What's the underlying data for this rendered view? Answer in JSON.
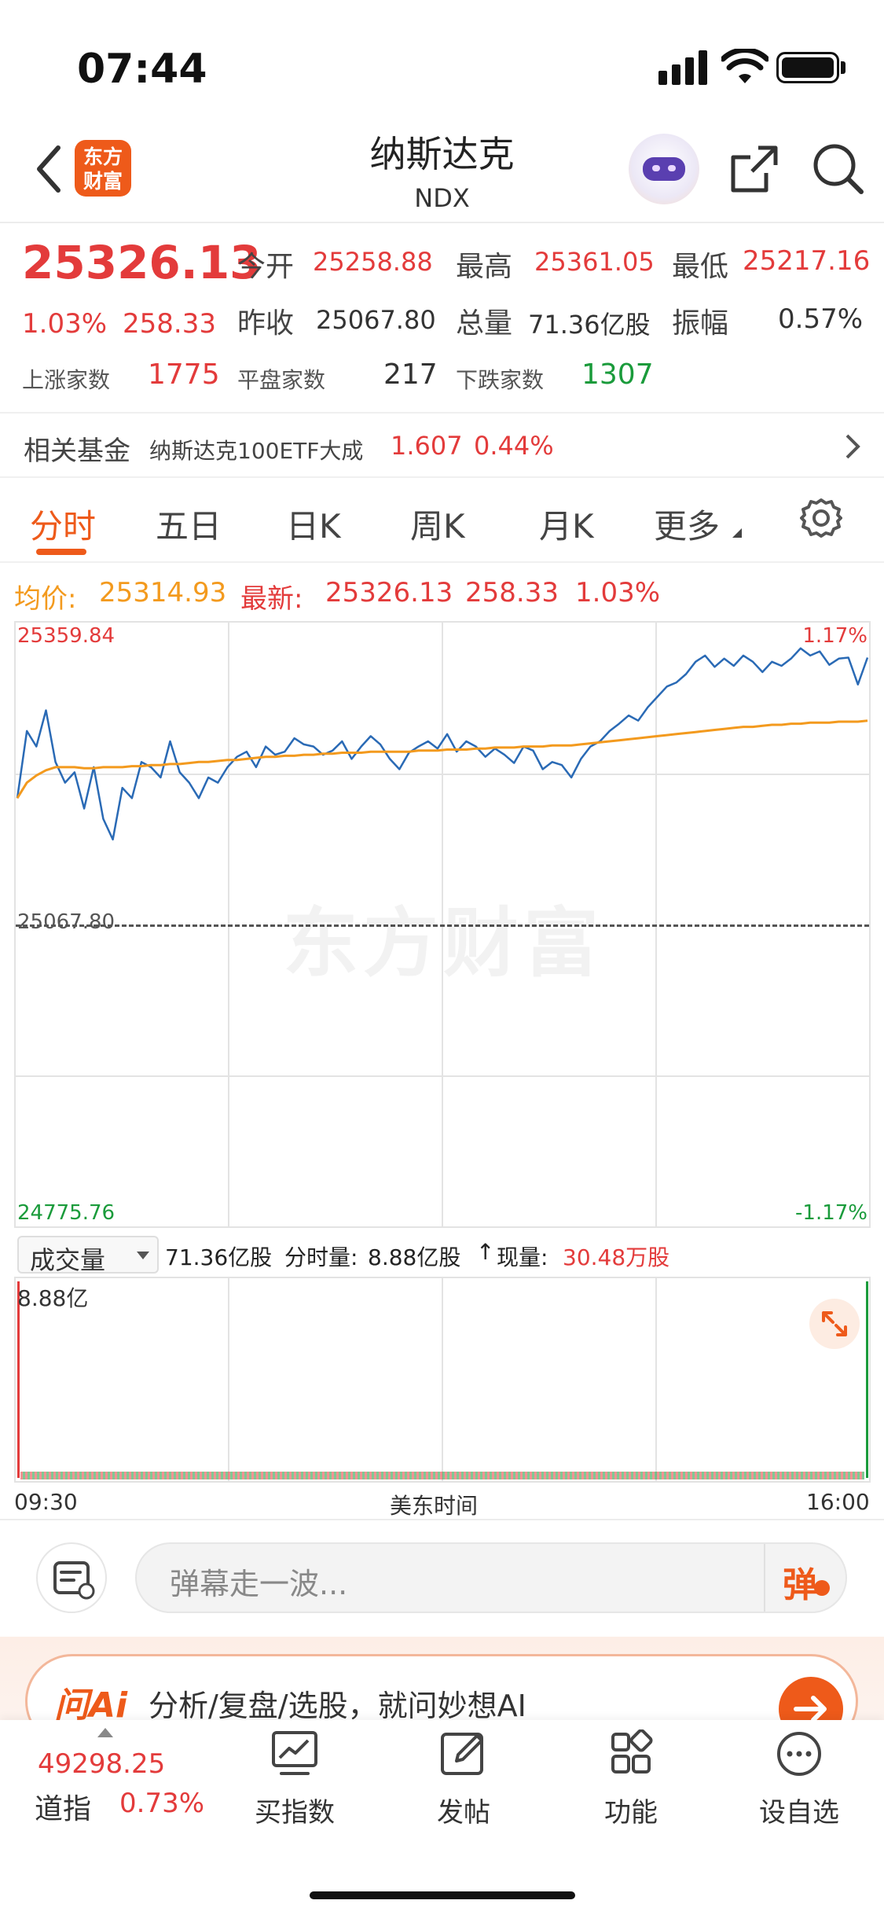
{
  "status_bar": {
    "time": "07:44"
  },
  "header": {
    "back_label": "‹",
    "logo_text_1": "东方",
    "logo_text_2": "财富",
    "title": "纳斯达克",
    "code": "NDX"
  },
  "quote": {
    "price": "25326.13",
    "change_pct": "1.03%",
    "change_abs": "258.33",
    "open_label": "今开",
    "open_value": "25258.88",
    "high_label": "最高",
    "high_value": "25361.05",
    "low_label": "最低",
    "low_value": "25217.16",
    "prev_close_label": "昨收",
    "prev_close_value": "25067.80",
    "volume_label": "总量",
    "volume_value": "71.36亿股",
    "amplitude_label": "振幅",
    "amplitude_value": "0.57%",
    "rise_label": "上涨家数",
    "rise_value": "1775",
    "flat_label": "平盘家数",
    "flat_value": "217",
    "fall_label": "下跌家数",
    "fall_value": "1307"
  },
  "fund_row": {
    "label": "相关基金",
    "name": "纳斯达克100ETF大成",
    "price": "1.607",
    "pct": "0.44%"
  },
  "tabs": [
    "分时",
    "五日",
    "日K",
    "周K",
    "月K",
    "更多"
  ],
  "chart_info": {
    "avg_label": "均价:",
    "avg_value": "25314.93",
    "latest_label": "最新:",
    "latest_value": "25326.13",
    "latest_change": "258.33",
    "latest_pct": "1.03%"
  },
  "chart_data": {
    "type": "line",
    "y_top_label": "25359.84",
    "y_mid_label": "25067.80",
    "y_bottom_label": "24775.76",
    "pct_top_label": "1.17%",
    "pct_bottom_label": "-1.17%",
    "ylim": [
      24775.76,
      25359.84
    ],
    "x_labels": [
      "09:30",
      "美东时间",
      "16:00"
    ],
    "watermark": "东方财富",
    "series": [
      {
        "values": [
          25190,
          25255,
          25240,
          25275,
          25225,
          25205,
          25215,
          25180,
          25220,
          25170,
          25150,
          25200,
          25190,
          25225,
          25220,
          25210,
          25245,
          25215,
          25205,
          25190,
          25210,
          25205,
          25220,
          25230,
          25235,
          25220,
          25240,
          25232,
          25235,
          25248,
          25242,
          25240,
          25232,
          25236,
          25245,
          25228,
          25240,
          25250,
          25242,
          25228,
          25218,
          25234,
          25240,
          25245,
          25238,
          25252,
          25235,
          25245,
          25240,
          25230,
          25238,
          25232,
          25224,
          25240,
          25236,
          25218,
          25225,
          25222,
          25210,
          25228,
          25240,
          25245,
          25255,
          25262,
          25270,
          25265,
          25278,
          25288,
          25298,
          25302,
          25310,
          25322,
          25328,
          25317,
          25325,
          25318,
          25328,
          25322,
          25312,
          25322,
          25318,
          25325,
          25335,
          25328,
          25332,
          25319,
          25325,
          25326,
          25300,
          25326
        ]
      },
      {
        "values": [
          25190,
          25205,
          25212,
          25217,
          25220,
          25220,
          25220,
          25219,
          25219,
          25220,
          25220,
          25220,
          25221,
          25221,
          25222,
          25222,
          25223,
          25223,
          25224,
          25225,
          25225,
          25226,
          25227,
          25227,
          25228,
          25229,
          25230,
          25230,
          25231,
          25231,
          25232,
          25232,
          25233,
          25233,
          25234,
          25234,
          25234,
          25235,
          25235,
          25235,
          25235,
          25235,
          25236,
          25236,
          25236,
          25237,
          25237,
          25237,
          25238,
          25238,
          25239,
          25239,
          25239,
          25240,
          25240,
          25240,
          25241,
          25241,
          25241,
          25242,
          25243,
          25244,
          25245,
          25246,
          25247,
          25248,
          25249,
          25250,
          25251,
          25252,
          25253,
          25254,
          25255,
          25256,
          25257,
          25258,
          25259,
          25259,
          25260,
          25261,
          25261,
          25262,
          25262,
          25263,
          25263,
          25263,
          25264,
          25264,
          25264,
          25265
        ]
      }
    ]
  },
  "volume_panel": {
    "selector_label": "成交量",
    "total": "71.36亿股",
    "period_label": "分时量:",
    "period_value": "8.88亿股",
    "arrow": "↑",
    "current_label": "现量:",
    "current_value": "30.48万股",
    "max_label": "8.88亿"
  },
  "comment": {
    "placeholder": "弹幕走一波...",
    "danmu_label": "弹"
  },
  "ai_banner": {
    "logo": "问Ai",
    "text": "分析/复盘/选股，就问妙想AI"
  },
  "bottom_nav": {
    "index_value": "49298.25",
    "index_name": "道指",
    "index_pct": "0.73%",
    "items": [
      "买指数",
      "发帖",
      "功能",
      "设自选"
    ]
  },
  "colors": {
    "up": "#e33b3b",
    "down": "#1a9b3b",
    "accent": "#ee5a1a",
    "line": "#2a6ab5",
    "avg": "#f39a1e"
  }
}
